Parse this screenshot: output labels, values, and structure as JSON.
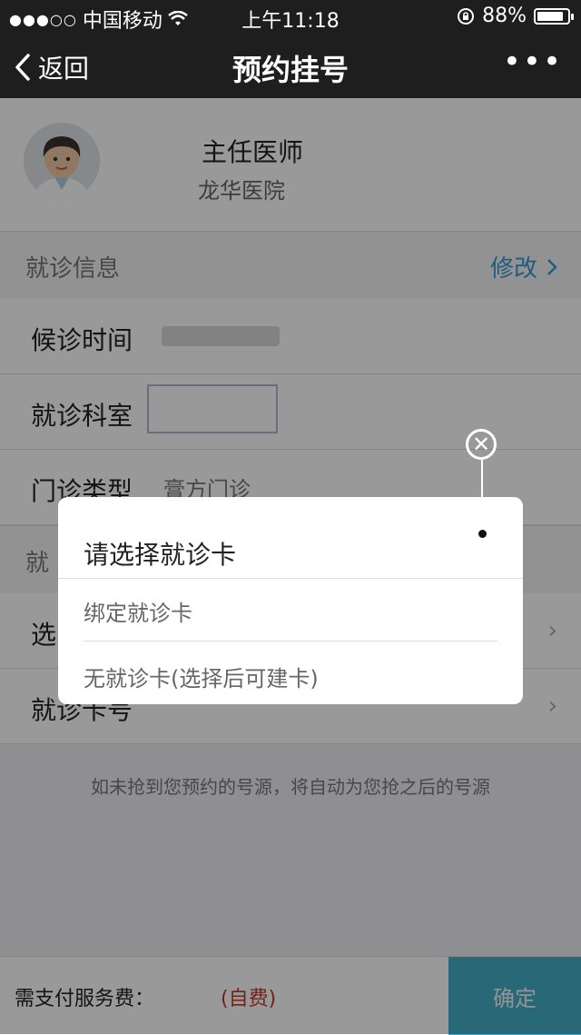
{
  "status_bar": {
    "signal": "●●●○○",
    "carrier": "中国移动",
    "time": "上午11:18",
    "battery": "88%",
    "battery_level": 0.88
  },
  "nav": {
    "back_label": "返回",
    "title": "预约挂号",
    "more": "•••"
  },
  "doctor": {
    "title": "主任医师",
    "hospital": "龙华医院"
  },
  "section_visit": {
    "label": "就诊信息",
    "edit_label": "修改"
  },
  "rows": {
    "wait_time_label": "候诊时间",
    "department_label": "就诊科室",
    "clinic_type_label": "门诊类型",
    "clinic_type_value": "膏方门诊",
    "select_label": "选",
    "card_label": "就诊卡号"
  },
  "section_card_label": "就",
  "notice": "如未抢到您预约的号源，将自动为您抢之后的号源",
  "bottom": {
    "fee_label": "需支付服务费：",
    "self_pay": "(自费)",
    "confirm": "确定"
  },
  "popup": {
    "title": "请选择就诊卡",
    "options": [
      "绑定就诊卡",
      "无就诊卡(选择后可建卡)"
    ]
  },
  "colors": {
    "accent_blue": "#3a98d6",
    "confirm_bg": "#45aec7",
    "self_pay_red": "#c0392b",
    "nav_bg": "#1e1e1e"
  }
}
